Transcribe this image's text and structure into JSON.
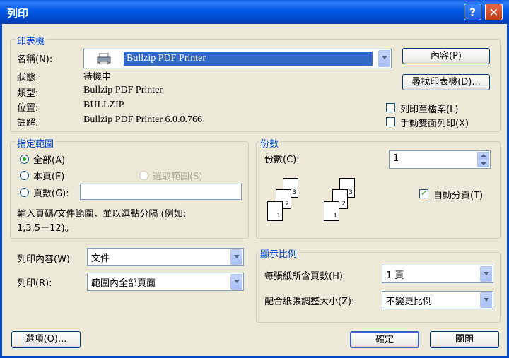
{
  "window": {
    "title": "列印",
    "help": "?",
    "close": "✕"
  },
  "printer": {
    "group_label": "印表機",
    "name_label": "名稱(N):",
    "name_value": "Bullzip PDF Printer",
    "properties_button": "內容(P)",
    "find_button": "尋找印表機(D)...",
    "status_label": "狀態:",
    "status_value": "待機中",
    "type_label": "類型:",
    "type_value": "Bullzip PDF Printer",
    "where_label": "位置:",
    "where_value": "BULLZIP",
    "comment_label": "註解:",
    "comment_value": "Bullzip PDF Printer 6.0.0.766",
    "print_to_file": "列印至檔案(L)",
    "manual_duplex": "手動雙面列印(X)"
  },
  "range": {
    "group_label": "指定範圍",
    "all": "全部(A)",
    "current": "本頁(E)",
    "selection": "選取範圍(S)",
    "pages": "頁數(G):",
    "pages_value": "",
    "hint_line1": "輸入頁碼/文件範圍，並以逗點分隔 (例如:",
    "hint_line2": "1,3,5－12)。"
  },
  "copies": {
    "group_label": "份數",
    "label": "份數(C):",
    "value": "1",
    "collate": "自動分頁(T)",
    "page_nums": [
      "1",
      "2",
      "3"
    ]
  },
  "print_what": {
    "label": "列印內容(W)",
    "value": "文件"
  },
  "print": {
    "label": "列印(R):",
    "value": "範圍內全部頁面"
  },
  "zoom": {
    "group_label": "顯示比例",
    "pages_per_sheet_label": "每張紙所含頁數(H)",
    "pages_per_sheet_value": "1 頁",
    "scale_label": "配合紙張調整大小(Z):",
    "scale_value": "不變更比例"
  },
  "footer": {
    "options": "選項(O)...",
    "ok": "確定",
    "cancel": "關閉"
  }
}
